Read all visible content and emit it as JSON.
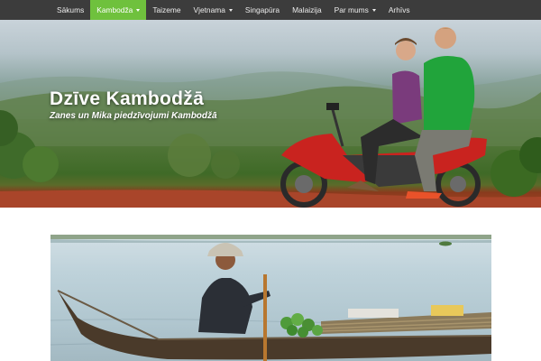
{
  "nav": {
    "items": [
      {
        "label": "Sākums",
        "active": false,
        "dropdown": false
      },
      {
        "label": "Kambodža",
        "active": true,
        "dropdown": true
      },
      {
        "label": "Taizeme",
        "active": false,
        "dropdown": false
      },
      {
        "label": "Vjetnama",
        "active": false,
        "dropdown": true
      },
      {
        "label": "Singapūra",
        "active": false,
        "dropdown": false
      },
      {
        "label": "Malaizija",
        "active": false,
        "dropdown": false
      },
      {
        "label": "Par mums",
        "active": false,
        "dropdown": true
      },
      {
        "label": "Arhīvs",
        "active": false,
        "dropdown": false
      }
    ]
  },
  "hero": {
    "title": "Dzīve Kambodžā",
    "subtitle": "Zanes un Mika piedzīvojumi Kambodžā"
  },
  "colors": {
    "nav_background": "#3c3c3c",
    "nav_active": "#6fc13d",
    "nav_text": "#ececec"
  }
}
